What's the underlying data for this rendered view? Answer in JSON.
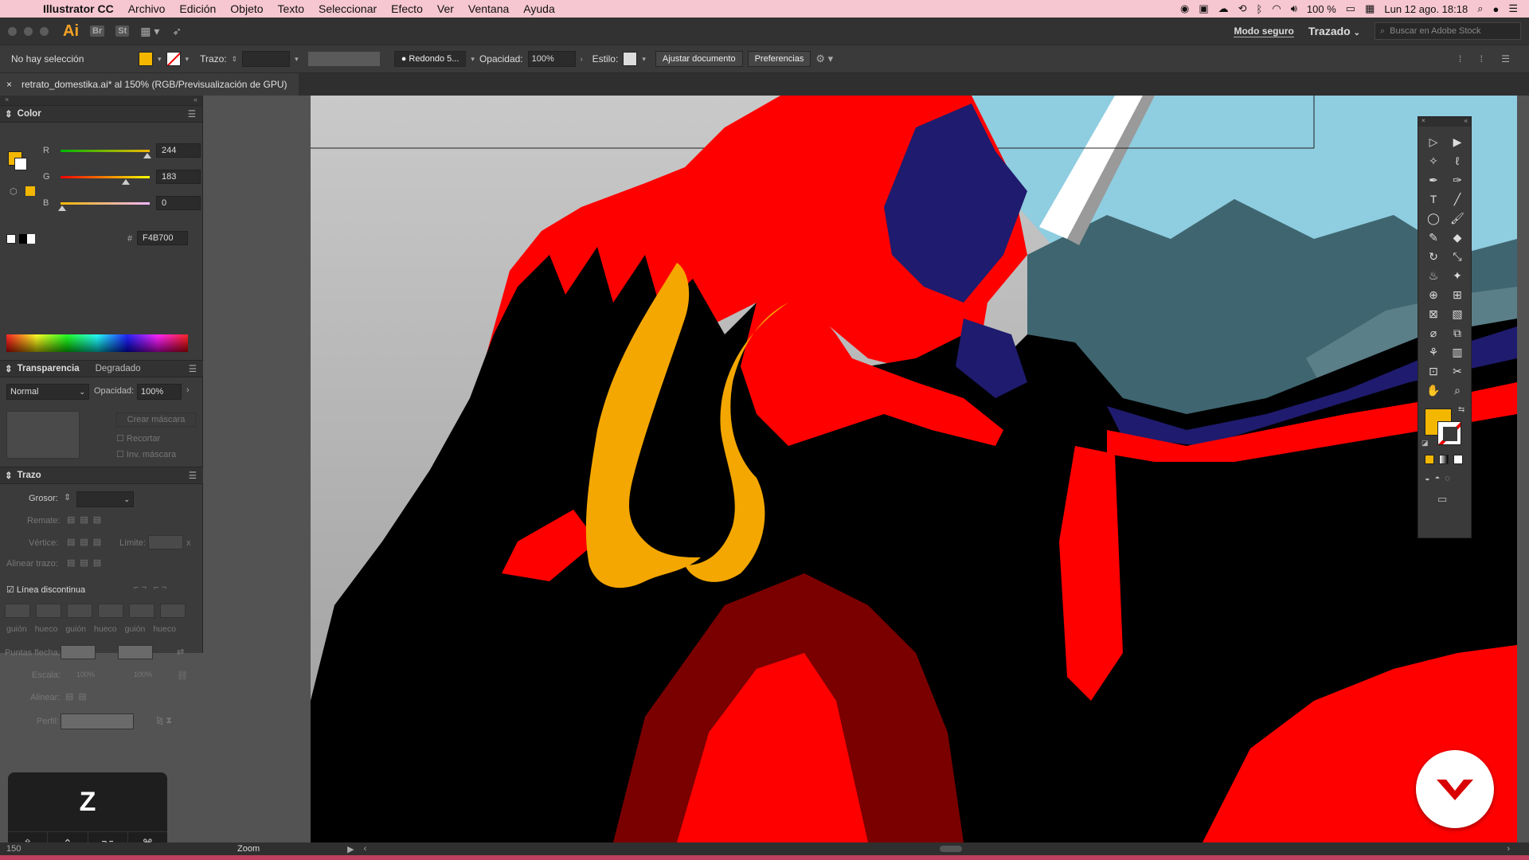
{
  "menubar": {
    "app_name": "Illustrator CC",
    "items": [
      "Archivo",
      "Edición",
      "Objeto",
      "Texto",
      "Seleccionar",
      "Efecto",
      "Ver",
      "Ventana",
      "Ayuda"
    ],
    "battery": "100 %",
    "datetime": "Lun 12 ago. 18:18"
  },
  "appbar": {
    "logo": "Ai",
    "bridge": "Br",
    "stock": "St",
    "modo_seguro": "Modo seguro",
    "workspace": "Trazado",
    "search_placeholder": "Buscar en Adobe Stock"
  },
  "controlbar": {
    "selection": "No hay selección",
    "fill_color": "#f4b700",
    "trazo_label": "Trazo:",
    "brush": "Redondo 5...",
    "opacity_label": "Opacidad:",
    "opacity_value": "100%",
    "style_label": "Estilo:",
    "ajustar": "Ajustar documento",
    "preferencias": "Preferencias"
  },
  "document": {
    "tab_title": "retrato_domestika.ai* al 150% (RGB/Previsualización de GPU)"
  },
  "color_panel": {
    "title": "Color",
    "r_label": "R",
    "r_value": "244",
    "g_label": "G",
    "g_value": "183",
    "b_label": "B",
    "b_value": "0",
    "hex_label": "#",
    "hex_value": "F4B700"
  },
  "transparency_panel": {
    "title": "Transparencia",
    "tab2": "Degradado",
    "blend_mode": "Normal",
    "opacity_label": "Opacidad:",
    "opacity_value": "100%",
    "make_mask": "Crear máscara",
    "clip": "Recortar",
    "invert": "Inv. máscara"
  },
  "stroke_panel": {
    "title": "Trazo",
    "weight_label": "Grosor:",
    "cap_label": "Remate:",
    "corner_label": "Vértice:",
    "limit_label": "Límite:",
    "limit_x": "x",
    "align_label": "Alinear trazo:",
    "dashed_label": "Línea discontinua",
    "dash_labels": [
      "guión",
      "hueco",
      "guión",
      "hueco",
      "guión",
      "hueco"
    ],
    "arrows_label": "Puntas flecha:",
    "scale_label": "Escala:",
    "scale_a": "100%",
    "scale_b": "100%",
    "align2_label": "Alinear:",
    "profile_label": "Perfil:"
  },
  "statusbar": {
    "zoom_label": "Zoom",
    "zoom_pct": "150"
  },
  "keycast": {
    "key": "Z",
    "mods": [
      "⇧",
      "⌃",
      "⌥",
      "⌘"
    ]
  },
  "colors": {
    "fill": "#f4b700",
    "accent_red": "#ff0000",
    "navy": "#1f1b6e",
    "sky": "#8fcde0"
  }
}
